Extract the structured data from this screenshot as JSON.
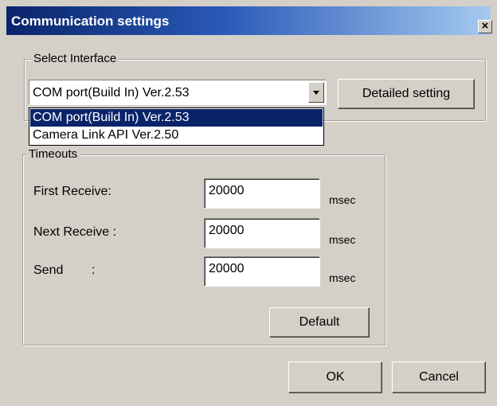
{
  "window": {
    "title": "Communication settings",
    "close_label": "×"
  },
  "select_interface": {
    "group_label": "Select Interface",
    "selected_value": "COM port(Build In) Ver.2.53",
    "detailed_setting_label": "Detailed setting",
    "options": [
      "COM port(Build In) Ver.2.53",
      "Camera Link API Ver.2.50"
    ]
  },
  "timeouts": {
    "group_label": "Timeouts",
    "fields": [
      {
        "label": "First Receive:",
        "value": "20000",
        "unit": "msec"
      },
      {
        "label": "Next Receive :",
        "value": "20000",
        "unit": "msec"
      },
      {
        "label": "Send        :",
        "value": "20000",
        "unit": "msec"
      }
    ],
    "default_label": "Default"
  },
  "footer": {
    "ok_label": "OK",
    "cancel_label": "Cancel"
  }
}
